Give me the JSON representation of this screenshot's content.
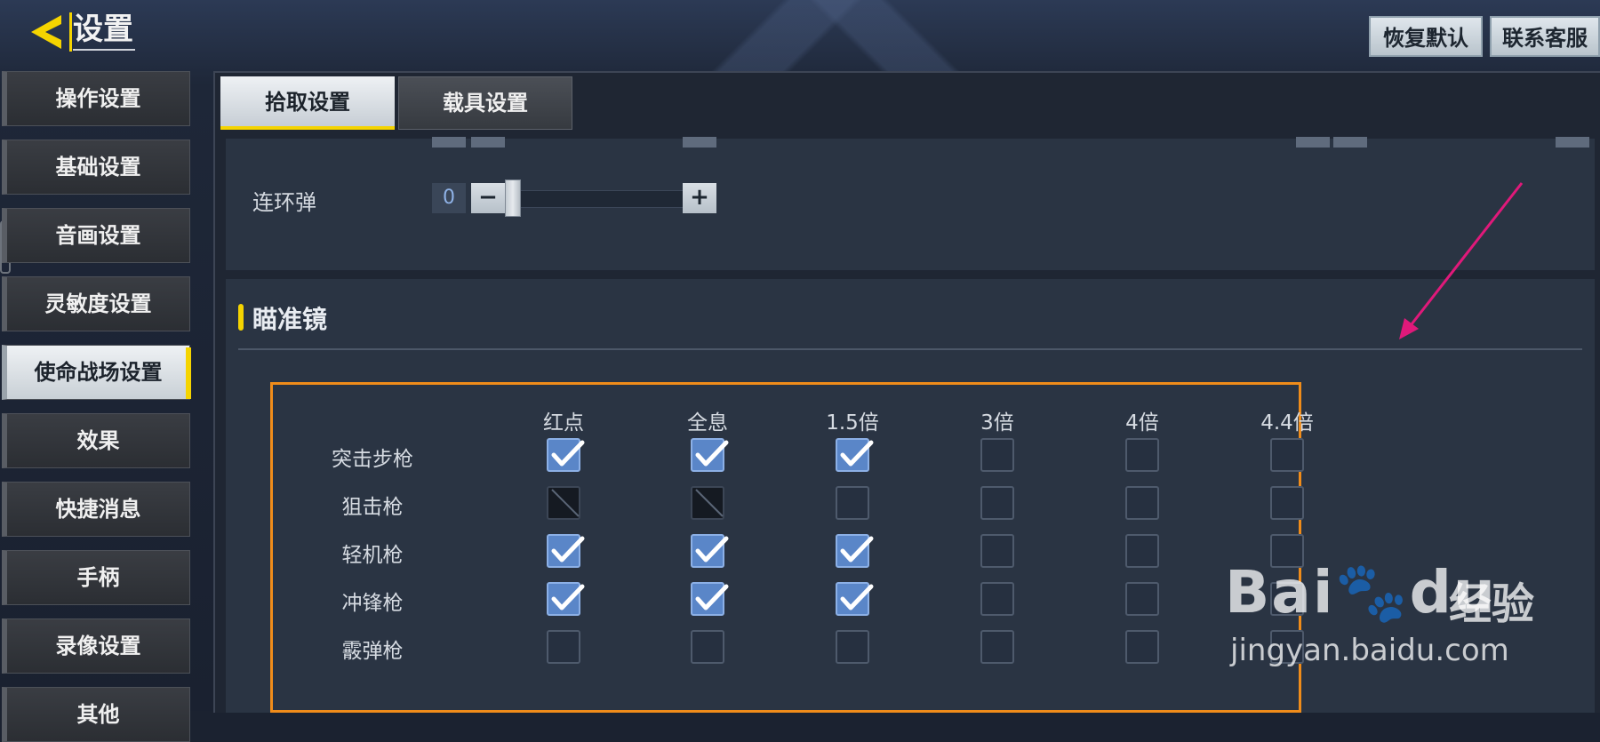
{
  "header": {
    "title": "设置",
    "reset_label": "恢复默认",
    "contact_label": "联系客服",
    "back_icon": "back-arrow-icon"
  },
  "sidebar": {
    "items": [
      {
        "label": "操作设置",
        "active": false
      },
      {
        "label": "基础设置",
        "active": false
      },
      {
        "label": "音画设置",
        "active": false
      },
      {
        "label": "灵敏度设置",
        "active": false
      },
      {
        "label": "使命战场设置",
        "active": true
      },
      {
        "label": "效果",
        "active": false
      },
      {
        "label": "快捷消息",
        "active": false
      },
      {
        "label": "手柄",
        "active": false
      },
      {
        "label": "录像设置",
        "active": false
      },
      {
        "label": "其他",
        "active": false
      }
    ]
  },
  "tabs": [
    {
      "label": "拾取设置",
      "active": true
    },
    {
      "label": "载具设置",
      "active": false
    }
  ],
  "top_section": {
    "slider": {
      "label": "连环弹",
      "value": "0",
      "minus": "−",
      "plus": "+"
    }
  },
  "scope_section": {
    "title": "瞄准镜",
    "columns": [
      "红点",
      "全息",
      "1.5倍",
      "3倍",
      "4倍",
      "4.4倍"
    ],
    "rows": [
      {
        "label": "突击步枪",
        "states": [
          "checked",
          "checked",
          "checked",
          "unchecked",
          "unchecked",
          "unchecked"
        ]
      },
      {
        "label": "狙击枪",
        "states": [
          "disabled",
          "disabled",
          "unchecked",
          "unchecked",
          "unchecked",
          "unchecked"
        ]
      },
      {
        "label": "轻机枪",
        "states": [
          "checked",
          "checked",
          "checked",
          "unchecked",
          "unchecked",
          "unchecked"
        ]
      },
      {
        "label": "冲锋枪",
        "states": [
          "checked",
          "checked",
          "checked",
          "unchecked",
          "unchecked",
          "unchecked"
        ]
      },
      {
        "label": "霰弹枪",
        "states": [
          "unchecked",
          "unchecked",
          "unchecked",
          "unchecked",
          "unchecked",
          "unchecked"
        ]
      }
    ]
  },
  "watermark": {
    "logo": "Bai",
    "logo2": "du",
    "cn": "经验",
    "url": "jingyan.baidu.com"
  },
  "colors": {
    "accent": "#f5d400",
    "highlight_box": "#f08c1a",
    "annotation_arrow": "#e0197a",
    "checkbox_checked": "#5a86c8"
  }
}
